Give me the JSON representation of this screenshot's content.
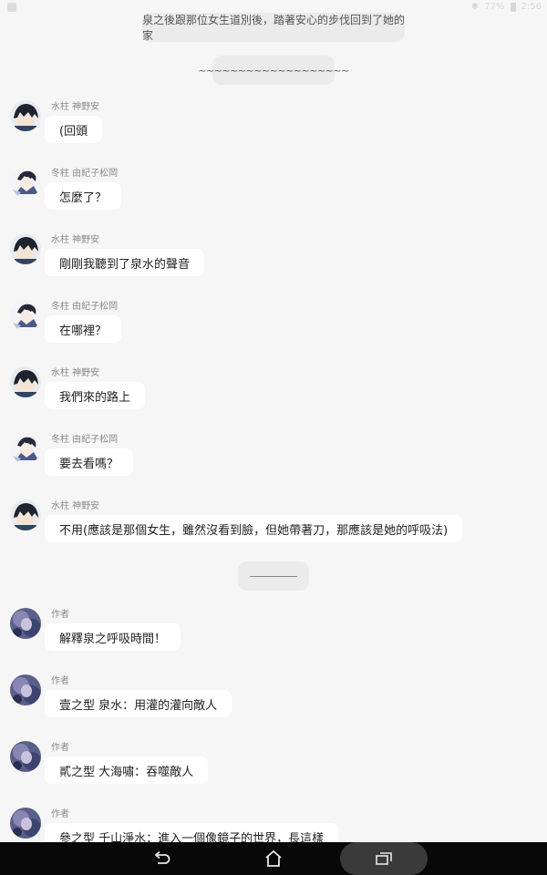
{
  "status_bar": {
    "battery": "77%",
    "time": "2:56"
  },
  "system_notes": [
    "泉之後跟那位女生道別後，踏著安心的步伐回到了她的家",
    "~~~~~~~~~~~~~~~~~~~"
  ],
  "messages": [
    {
      "sender": "水柱 神野安",
      "text": "(回頭",
      "avatar": "dark-hair-character"
    },
    {
      "sender": "冬柱 由紀子松岡",
      "text": "怎麼了？",
      "avatar": "anime-character-sketch"
    },
    {
      "sender": "水柱 神野安",
      "text": "剛剛我聽到了泉水的聲音",
      "avatar": "dark-hair-character"
    },
    {
      "sender": "冬柱 由紀子松岡",
      "text": "在哪裡？",
      "avatar": "anime-character-sketch"
    },
    {
      "sender": "水柱 神野安",
      "text": "我們來的路上",
      "avatar": "dark-hair-character"
    },
    {
      "sender": "冬柱 由紀子松岡",
      "text": "要去看嗎？",
      "avatar": "anime-character-sketch"
    },
    {
      "sender": "水柱 神野安",
      "text": "不用(應該是那個女生，雖然沒看到臉，但她帶著刀，那應該是她的呼吸法)",
      "avatar": "dark-hair-character"
    },
    {
      "sender": "作者",
      "text": "解釋泉之呼吸時間！",
      "avatar": "author-avatar"
    },
    {
      "sender": "作者",
      "text": "壹之型 泉水：用灌的灌向敵人",
      "avatar": "author-avatar"
    },
    {
      "sender": "作者",
      "text": "貳之型 大海嘯：吞噬敵人",
      "avatar": "author-avatar"
    },
    {
      "sender": "作者",
      "text": "參之型 千山淨水：進入一個像鏡子的世界，長這樣",
      "avatar": "author-avatar"
    }
  ],
  "colors": {
    "background": "#f6f6f6",
    "bubble": "#ffffff",
    "pill": "#ebebeb",
    "navbar": "#080808"
  }
}
